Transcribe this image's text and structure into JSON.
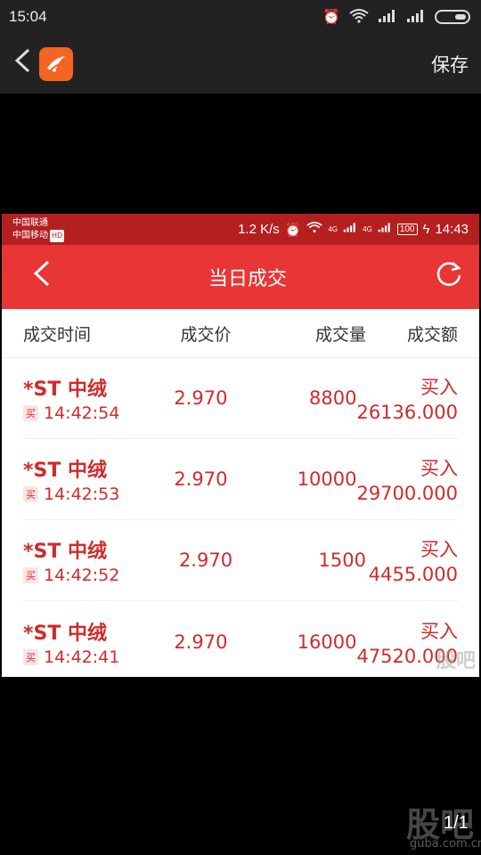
{
  "status_bar": {
    "time": "15:04",
    "icons": [
      "alarm-icon",
      "wifi-icon",
      "signal-icon",
      "signal-icon",
      "battery-icon"
    ]
  },
  "viewer": {
    "save_label": "保存",
    "pager": "1/1",
    "watermark": "股吧",
    "watermark_url": "guba.com.cn"
  },
  "inner": {
    "carrier1": "中国联通",
    "carrier2": "中国移动",
    "hd": "HD",
    "net_speed": "1.2 K/s",
    "net_4g_a": "4G",
    "net_4g_b": "4G",
    "battery": "100",
    "time": "14:43",
    "title": "当日成交",
    "columns": [
      "成交时间",
      "成交价",
      "成交量",
      "成交额"
    ],
    "watermark": "股吧",
    "rows": [
      {
        "name": "*ST 中绒",
        "tag": "买",
        "time": "14:42:54",
        "price": "2.970",
        "volume": "8800",
        "side": "买入",
        "amount": "26136.000"
      },
      {
        "name": "*ST 中绒",
        "tag": "买",
        "time": "14:42:53",
        "price": "2.970",
        "volume": "10000",
        "side": "买入",
        "amount": "29700.000"
      },
      {
        "name": "*ST 中绒",
        "tag": "买",
        "time": "14:42:52",
        "price": "2.970",
        "volume": "1500",
        "side": "买入",
        "amount": "4455.000"
      },
      {
        "name": "*ST 中绒",
        "tag": "买",
        "time": "14:42:41",
        "price": "2.970",
        "volume": "16000",
        "side": "买入",
        "amount": "47520.000"
      }
    ]
  }
}
